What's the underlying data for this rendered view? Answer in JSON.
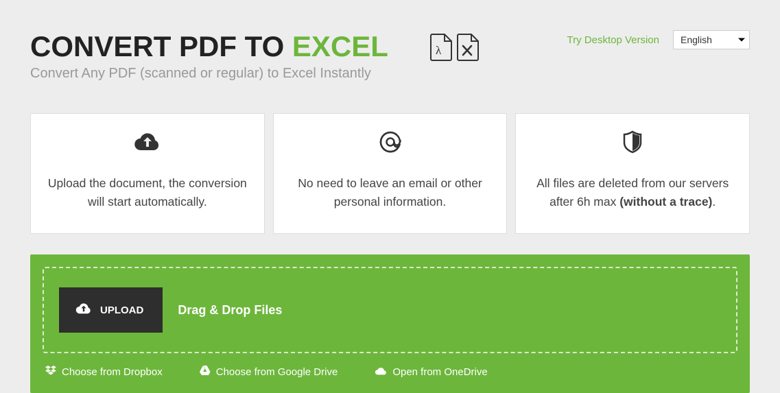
{
  "header": {
    "title_prefix": "CONVERT PDF TO ",
    "title_accent": "EXCEL",
    "subtitle": "Convert Any PDF (scanned or regular) to Excel Instantly",
    "try_link": "Try Desktop Version",
    "language_selected": "English"
  },
  "cards": [
    {
      "text": "Upload the document, the conversion will start automatically."
    },
    {
      "text": "No need to leave an email or other personal information."
    },
    {
      "text_before": "All files are deleted from our servers after 6h max ",
      "text_bold": "(without a trace)",
      "text_after": "."
    }
  ],
  "upload": {
    "button_label": "UPLOAD",
    "drop_label": "Drag & Drop Files",
    "sources": {
      "dropbox": "Choose from Dropbox",
      "gdrive": "Choose from Google Drive",
      "onedrive": "Open from OneDrive"
    }
  }
}
